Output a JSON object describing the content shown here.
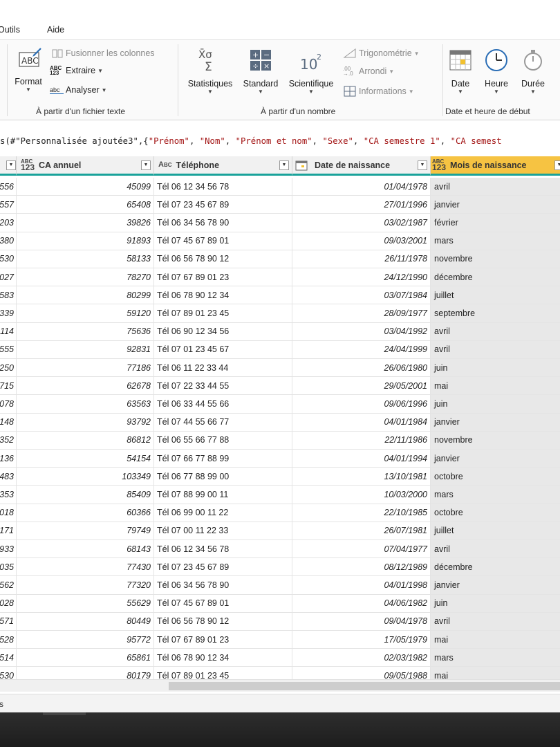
{
  "menu": {
    "tools": "Outils",
    "help": "Aide"
  },
  "ribbon": {
    "text_group": {
      "format_label": "Format",
      "merge_columns": "Fusionner les colonnes",
      "extract": "Extraire",
      "parse": "Analyser",
      "group_label": "À partir d'un fichier texte"
    },
    "number_group": {
      "statistics": "Statistiques",
      "standard": "Standard",
      "scientific": "Scientifique",
      "trigonometry": "Trigonométrie",
      "rounding": "Arrondi",
      "information": "Informations",
      "group_label": "À partir d'un nombre"
    },
    "datetime_group": {
      "date": "Date",
      "time": "Heure",
      "duration": "Durée",
      "group_label": "Date et heure de début"
    }
  },
  "formula": {
    "prefix": "s(#\"Personnalisée ajoutée3\",{",
    "parts": [
      "\"Prénom\"",
      "\"Nom\"",
      "\"Prénom et nom\"",
      "\"Sexe\"",
      "\"CA semestre 1\"",
      "\"CA semest"
    ]
  },
  "columns": {
    "ca_annuel": "CA annuel",
    "telephone": "Téléphone",
    "date_naissance": "Date de naissance",
    "mois_naissance": "Mois de naissance"
  },
  "rows": [
    [
      "556",
      "45099",
      "Tél  06 12 34 56 78",
      "01/04/1978",
      "avril"
    ],
    [
      "557",
      "65408",
      "Tél  07 23 45 67 89",
      "27/01/1996",
      "janvier"
    ],
    [
      "203",
      "39826",
      "Tél  06 34 56 78 90",
      "03/02/1987",
      "février"
    ],
    [
      "380",
      "91893",
      "Tél  07 45 67 89 01",
      "09/03/2001",
      "mars"
    ],
    [
      "530",
      "58133",
      "Tél  06 56 78 90 12",
      "26/11/1978",
      "novembre"
    ],
    [
      "027",
      "78270",
      "Tél  07 67 89 01 23",
      "24/12/1990",
      "décembre"
    ],
    [
      "583",
      "80299",
      "Tél  06 78 90 12 34",
      "03/07/1984",
      "juillet"
    ],
    [
      "339",
      "59120",
      "Tél  07 89 01 23 45",
      "28/09/1977",
      "septembre"
    ],
    [
      "114",
      "75636",
      "Tél  06 90 12 34 56",
      "03/04/1992",
      "avril"
    ],
    [
      "555",
      "92831",
      "Tél  07 01 23 45 67",
      "24/04/1999",
      "avril"
    ],
    [
      "250",
      "77186",
      "Tél  06 11 22 33 44",
      "26/06/1980",
      "juin"
    ],
    [
      "715",
      "62678",
      "Tél  07 22 33 44 55",
      "29/05/2001",
      "mai"
    ],
    [
      "078",
      "63563",
      "Tél  06 33 44 55 66",
      "09/06/1996",
      "juin"
    ],
    [
      "148",
      "93792",
      "Tél  07 44 55 66 77",
      "04/01/1984",
      "janvier"
    ],
    [
      "352",
      "86812",
      "Tél  06 55 66 77 88",
      "22/11/1986",
      "novembre"
    ],
    [
      "136",
      "54154",
      "Tél  07 66 77 88 99",
      "04/01/1994",
      "janvier"
    ],
    [
      "483",
      "103349",
      "Tél  06 77 88 99 00",
      "13/10/1981",
      "octobre"
    ],
    [
      "353",
      "85409",
      "Tél  07 88 99 00 11",
      "10/03/2000",
      "mars"
    ],
    [
      "018",
      "60366",
      "Tél  06 99 00 11 22",
      "22/10/1985",
      "octobre"
    ],
    [
      "171",
      "79749",
      "Tél  07 00 11 22 33",
      "26/07/1981",
      "juillet"
    ],
    [
      "933",
      "68143",
      "Tél  06 12 34 56 78",
      "07/04/1977",
      "avril"
    ],
    [
      "035",
      "77430",
      "Tél  07 23 45 67 89",
      "08/12/1989",
      "décembre"
    ],
    [
      "562",
      "77320",
      "Tél  06 34 56 78 90",
      "04/01/1998",
      "janvier"
    ],
    [
      "028",
      "55629",
      "Tél  07 45 67 89 01",
      "04/06/1982",
      "juin"
    ],
    [
      "571",
      "80449",
      "Tél  06 56 78 90 12",
      "09/04/1978",
      "avril"
    ],
    [
      "528",
      "95772",
      "Tél  07 67 89 01 23",
      "17/05/1979",
      "mai"
    ],
    [
      "514",
      "65861",
      "Tél  06 78 90 12 34",
      "02/03/1982",
      "mars"
    ],
    [
      "530",
      "80179",
      "Tél  07 89 01 23 45",
      "09/05/1988",
      "mai"
    ]
  ],
  "status": {
    "text": "s"
  },
  "colors": {
    "accent": "#19a29a",
    "selected_header": "#f6c342",
    "selected_column": "#e8e8e8"
  },
  "icons": [
    "format-abc-icon",
    "merge-columns-icon",
    "extract-icon",
    "parse-icon",
    "statistics-sigma-icon",
    "standard-operators-icon",
    "scientific-power-icon",
    "trigonometry-icon",
    "rounding-icon",
    "information-icon",
    "date-calendar-icon",
    "clock-icon",
    "stopwatch-icon"
  ]
}
